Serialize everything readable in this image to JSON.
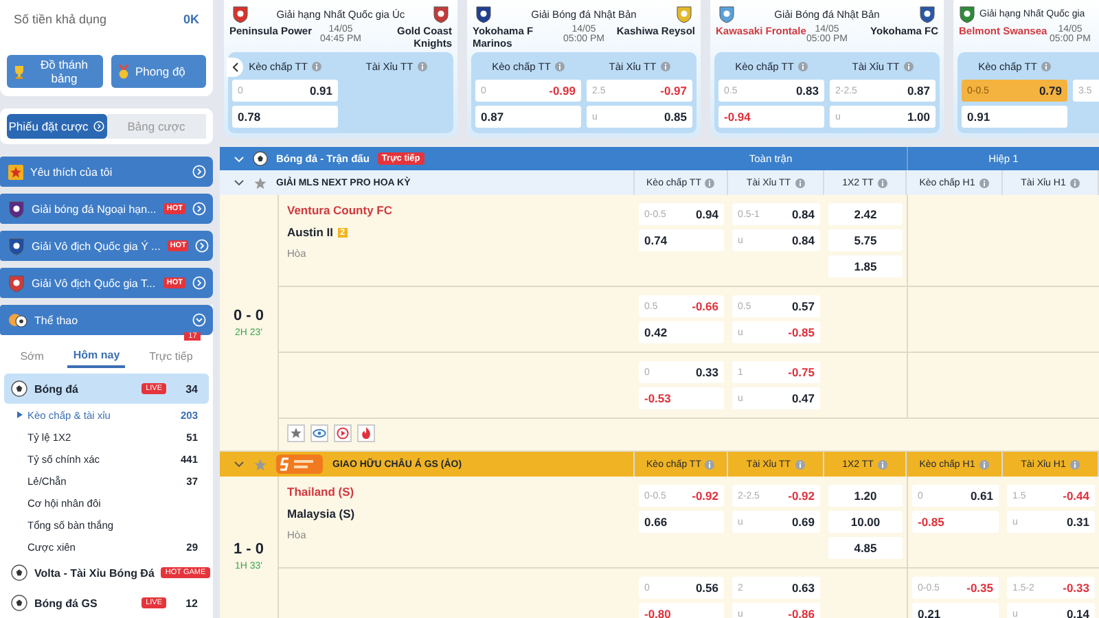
{
  "balance": {
    "label": "Số tiền khả dụng",
    "value": "0K"
  },
  "promo_buttons": [
    {
      "label": "Đồ thánh bảng",
      "kind": "trophy"
    },
    {
      "label": "Phong độ",
      "kind": "medal"
    }
  ],
  "bet_tabs": [
    {
      "label": "Phiếu đặt cược",
      "selected": true
    },
    {
      "label": "Bảng cược",
      "selected": false
    }
  ],
  "sidebar_leagues": [
    {
      "label": "Yêu thích của tôi",
      "kind": "favorite"
    },
    {
      "label": "Giải bóng đá Ngoại hạn...",
      "kind": "league",
      "badge": "HOT"
    },
    {
      "label": "Giải Vô địch Quốc gia Ý ...",
      "kind": "league",
      "badge": "HOT"
    },
    {
      "label": "Giải Vô địch Quốc gia T...",
      "kind": "league",
      "badge": "HOT"
    }
  ],
  "sports": {
    "title": "Thể thao",
    "expanded": true,
    "tabs": [
      {
        "label": "Sớm",
        "selected": false
      },
      {
        "label": "Hôm nay",
        "selected": true
      },
      {
        "label": "Trực tiếp",
        "selected": false,
        "count": "17"
      }
    ],
    "items": [
      {
        "label": "Bóng đá",
        "badge": "LIVE",
        "count": "34",
        "selected": true,
        "expanded": true,
        "children": [
          {
            "label": "Kèo chấp & tài xỉu",
            "count": "203",
            "selected": true
          },
          {
            "label": "Tỷ lệ 1X2",
            "count": "51",
            "selected": false
          },
          {
            "label": "Tỷ số chính xác",
            "count": "441",
            "selected": false
          },
          {
            "label": "Lẻ/Chẵn",
            "count": "37",
            "selected": false
          },
          {
            "label": "Cơ hội nhân đôi",
            "selected": false
          },
          {
            "label": "Tổng số bàn thắng",
            "selected": false
          },
          {
            "label": "Cược xiên",
            "count": "29",
            "selected": false
          }
        ]
      },
      {
        "label": "Volta - Tài Xỉu Bóng Đá",
        "badge": "HOT GAME",
        "selected": false,
        "expanded": false
      },
      {
        "label": "Bóng đá GS",
        "badge": "LIVE",
        "count": "12",
        "selected": false,
        "expanded": false
      }
    ]
  },
  "match_cards": [
    {
      "league": "Giải hạng Nhất Quốc gia Úc",
      "home": {
        "name": "Peninsula Power",
        "favorite": false
      },
      "away": {
        "name": "Gold Coast Knights",
        "favorite": false
      },
      "date": "14/05",
      "time": "04:45 PM",
      "show_prev": true,
      "columns": [
        {
          "header": "Kèo chấp TT",
          "cells": [
            {
              "line": "0",
              "value": "0.91",
              "negative": false,
              "highlighted": false
            },
            {
              "value": "0.78",
              "negative": false,
              "highlighted": false
            }
          ]
        },
        {
          "header": "Tài Xỉu TT"
        }
      ]
    },
    {
      "league": "Giải Bóng đá Nhật Bản",
      "home": {
        "name": "Yokohama F Marinos",
        "favorite": false
      },
      "away": {
        "name": "Kashiwa Reysol",
        "favorite": false
      },
      "date": "14/05",
      "time": "05:00 PM",
      "columns": [
        {
          "header": "Kèo chấp TT",
          "cells": [
            {
              "line": "0",
              "value": "-0.99",
              "negative": true,
              "highlighted": false
            },
            {
              "value": "0.87",
              "negative": false,
              "highlighted": false
            }
          ]
        },
        {
          "header": "Tài Xỉu TT",
          "cells": [
            {
              "line": "2.5",
              "value": "-0.97",
              "negative": true,
              "highlighted": false
            },
            {
              "line": "u",
              "value": "0.85",
              "negative": false,
              "highlighted": false
            }
          ]
        }
      ]
    },
    {
      "league": "Giải Bóng đá Nhật Bản",
      "home": {
        "name": "Kawasaki Frontale",
        "favorite": true
      },
      "away": {
        "name": "Yokohama FC",
        "favorite": false
      },
      "date": "14/05",
      "time": "05:00 PM",
      "columns": [
        {
          "header": "Kèo chấp TT",
          "cells": [
            {
              "line": "0.5",
              "value": "0.83",
              "negative": false,
              "highlighted": false
            },
            {
              "value": "-0.94",
              "negative": true,
              "highlighted": false
            }
          ]
        },
        {
          "header": "Tài Xỉu TT",
          "cells": [
            {
              "line": "2-2.5",
              "value": "0.87",
              "negative": false,
              "highlighted": false
            },
            {
              "line": "u",
              "value": "1.00",
              "negative": false,
              "highlighted": false
            }
          ]
        }
      ]
    },
    {
      "league": "Giải hạng Nhất Quốc gia",
      "home": {
        "name": "Belmont Swansea",
        "favorite": true
      },
      "date": "14/05",
      "time": "05:00 PM",
      "columns": [
        {
          "header": "Kèo chấp TT",
          "cells": [
            {
              "line": "0-0.5",
              "value": "0.79",
              "negative": false,
              "highlighted": true
            },
            {
              "value": "0.91",
              "negative": false,
              "highlighted": false
            }
          ]
        },
        {
          "cells": [
            {
              "line": "3.5"
            }
          ]
        }
      ]
    }
  ],
  "table": {
    "title": "Bóng đá - Trận đấu",
    "live_badge": "Trực tiếp",
    "groups": [
      "Toàn trận",
      "Hiệp 1"
    ],
    "leagues": [
      {
        "name": "GIẢI MLS NEXT PRO HOA KỲ",
        "kind": "real",
        "columns": [
          "Kèo chấp TT",
          "Tài Xỉu TT",
          "1X2 TT",
          "Kèo chấp H1",
          "Tài Xỉu H1"
        ],
        "matches": [
          {
            "score": "0 - 0",
            "time": "2H 23'",
            "home": {
              "name": "Ventura County FC",
              "favorite": true
            },
            "away": {
              "name": "Austin II",
              "favorite": false,
              "card": "2"
            },
            "draw": "Hòa",
            "tools": true,
            "rows": [
              {
                "hdp": [
                  {
                    "line": "0-0.5",
                    "value": "0.94",
                    "negative": false
                  },
                  {
                    "value": "0.74",
                    "negative": false
                  }
                ],
                "ou": [
                  {
                    "line": "0.5-1",
                    "value": "0.84",
                    "negative": false
                  },
                  {
                    "line": "u",
                    "value": "0.84",
                    "negative": false
                  }
                ],
                "x12": [
                  {
                    "value": "2.42",
                    "negative": false
                  },
                  {
                    "value": "5.75",
                    "negative": false
                  },
                  {
                    "value": "1.85",
                    "negative": false
                  }
                ]
              },
              {
                "hdp": [
                  {
                    "line": "0.5",
                    "value": "-0.66",
                    "negative": true
                  },
                  {
                    "value": "0.42",
                    "negative": false
                  }
                ],
                "ou": [
                  {
                    "line": "0.5",
                    "value": "0.57",
                    "negative": false
                  },
                  {
                    "line": "u",
                    "value": "-0.85",
                    "negative": true
                  }
                ]
              },
              {
                "hdp": [
                  {
                    "line": "0",
                    "value": "0.33",
                    "negative": false
                  },
                  {
                    "value": "-0.53",
                    "negative": true
                  }
                ],
                "ou": [
                  {
                    "line": "1",
                    "value": "-0.75",
                    "negative": true
                  },
                  {
                    "line": "u",
                    "value": "0.47",
                    "negative": false
                  }
                ]
              }
            ]
          }
        ]
      },
      {
        "name": "GIAO HỮU CHÂU Á GS (ẢO)",
        "kind": "virtual",
        "columns": [
          "Kèo chấp TT",
          "Tài Xỉu TT",
          "1X2 TT",
          "Kèo chấp H1",
          "Tài Xỉu H1"
        ],
        "matches": [
          {
            "score": "1 - 0",
            "time": "1H 33'",
            "home": {
              "name": "Thailand (S)",
              "favorite": true
            },
            "away": {
              "name": "Malaysia (S)",
              "favorite": false
            },
            "draw": "Hòa",
            "tools": false,
            "rows": [
              {
                "hdp": [
                  {
                    "line": "0-0.5",
                    "value": "-0.92",
                    "negative": true
                  },
                  {
                    "value": "0.66",
                    "negative": false
                  }
                ],
                "ou": [
                  {
                    "line": "2-2.5",
                    "value": "-0.92",
                    "negative": true
                  },
                  {
                    "line": "u",
                    "value": "0.69",
                    "negative": false
                  }
                ],
                "x12": [
                  {
                    "value": "1.20",
                    "negative": false
                  },
                  {
                    "value": "10.00",
                    "negative": false
                  },
                  {
                    "value": "4.85",
                    "negative": false
                  }
                ],
                "h1hdp": [
                  {
                    "line": "0",
                    "value": "0.61",
                    "negative": false
                  },
                  {
                    "value": "-0.85",
                    "negative": true
                  }
                ],
                "h1ou": [
                  {
                    "line": "1.5",
                    "value": "-0.44",
                    "negative": true
                  },
                  {
                    "line": "u",
                    "value": "0.31",
                    "negative": false
                  }
                ]
              },
              {
                "hdp": [
                  {
                    "line": "0",
                    "value": "0.56",
                    "negative": false
                  },
                  {
                    "value": "-0.80",
                    "negative": true
                  }
                ],
                "ou": [
                  {
                    "line": "2",
                    "value": "0.63",
                    "negative": false
                  },
                  {
                    "line": "u",
                    "value": "-0.86",
                    "negative": true
                  }
                ],
                "h1hdp": [
                  {
                    "line": "0-0.5",
                    "value": "-0.35",
                    "negative": true
                  },
                  {
                    "value": "0.21",
                    "negative": false
                  }
                ],
                "h1ou": [
                  {
                    "line": "1.5-2",
                    "value": "-0.33",
                    "negative": true
                  },
                  {
                    "line": "u",
                    "value": "0.14",
                    "negative": false
                  }
                ]
              }
            ]
          }
        ]
      }
    ]
  }
}
